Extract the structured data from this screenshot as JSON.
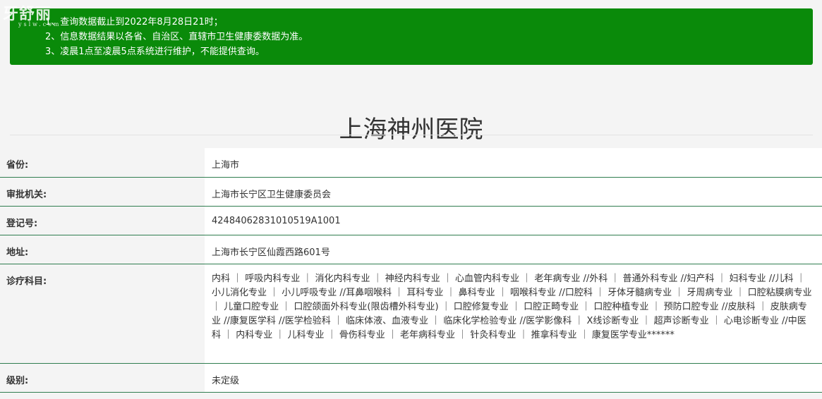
{
  "watermark": {
    "logo": "牙舒丽",
    "sub": "yslw.com"
  },
  "notice": {
    "line1": "1、查询数据截止到2022年8月28日21时；",
    "line2": "2、信息数据结果以各省、自治区、直辖市卫生健康委数据为准。",
    "line3": "3、凌晨1点至凌晨5点系统进行维护，不能提供查询。"
  },
  "hospital": {
    "name": "上海神州医院"
  },
  "rows": [
    {
      "label": "省份:",
      "value": "上海市"
    },
    {
      "label": "审批机关:",
      "value": "上海市长宁区卫生健康委员会"
    },
    {
      "label": "登记号:",
      "value": "42484062831010519A1001"
    },
    {
      "label": "地址:",
      "value": "上海市长宁区仙霞西路601号"
    },
    {
      "label": "诊疗科目:",
      "value": "内科 ｜ 呼吸内科专业 ｜ 消化内科专业 ｜ 神经内科专业 ｜ 心血管内科专业 ｜ 老年病专业 //外科 ｜ 普通外科专业 //妇产科 ｜ 妇科专业 //儿科 ｜ 小儿消化专业 ｜ 小儿呼吸专业 //耳鼻咽喉科 ｜ 耳科专业 ｜ 鼻科专业 ｜ 咽喉科专业 //口腔科 ｜ 牙体牙髓病专业 ｜ 牙周病专业 ｜ 口腔粘膜病专业 ｜ 儿童口腔专业 ｜ 口腔颌面外科专业(限齿槽外科专业) ｜ 口腔修复专业 ｜ 口腔正畸专业 ｜ 口腔种植专业 ｜ 预防口腔专业 //皮肤科 ｜ 皮肤病专业 //康复医学科 //医学检验科 ｜ 临床体液、血液专业 ｜ 临床化学检验专业 //医学影像科 ｜ X线诊断专业 ｜ 超声诊断专业 ｜ 心电诊断专业 //中医科 ｜ 内科专业 ｜ 儿科专业 ｜ 骨伤科专业 ｜ 老年病科专业 ｜ 针灸科专业 ｜ 推拿科专业 ｜ 康复医学专业******"
    },
    {
      "label": "级别:",
      "value": "未定级"
    }
  ]
}
